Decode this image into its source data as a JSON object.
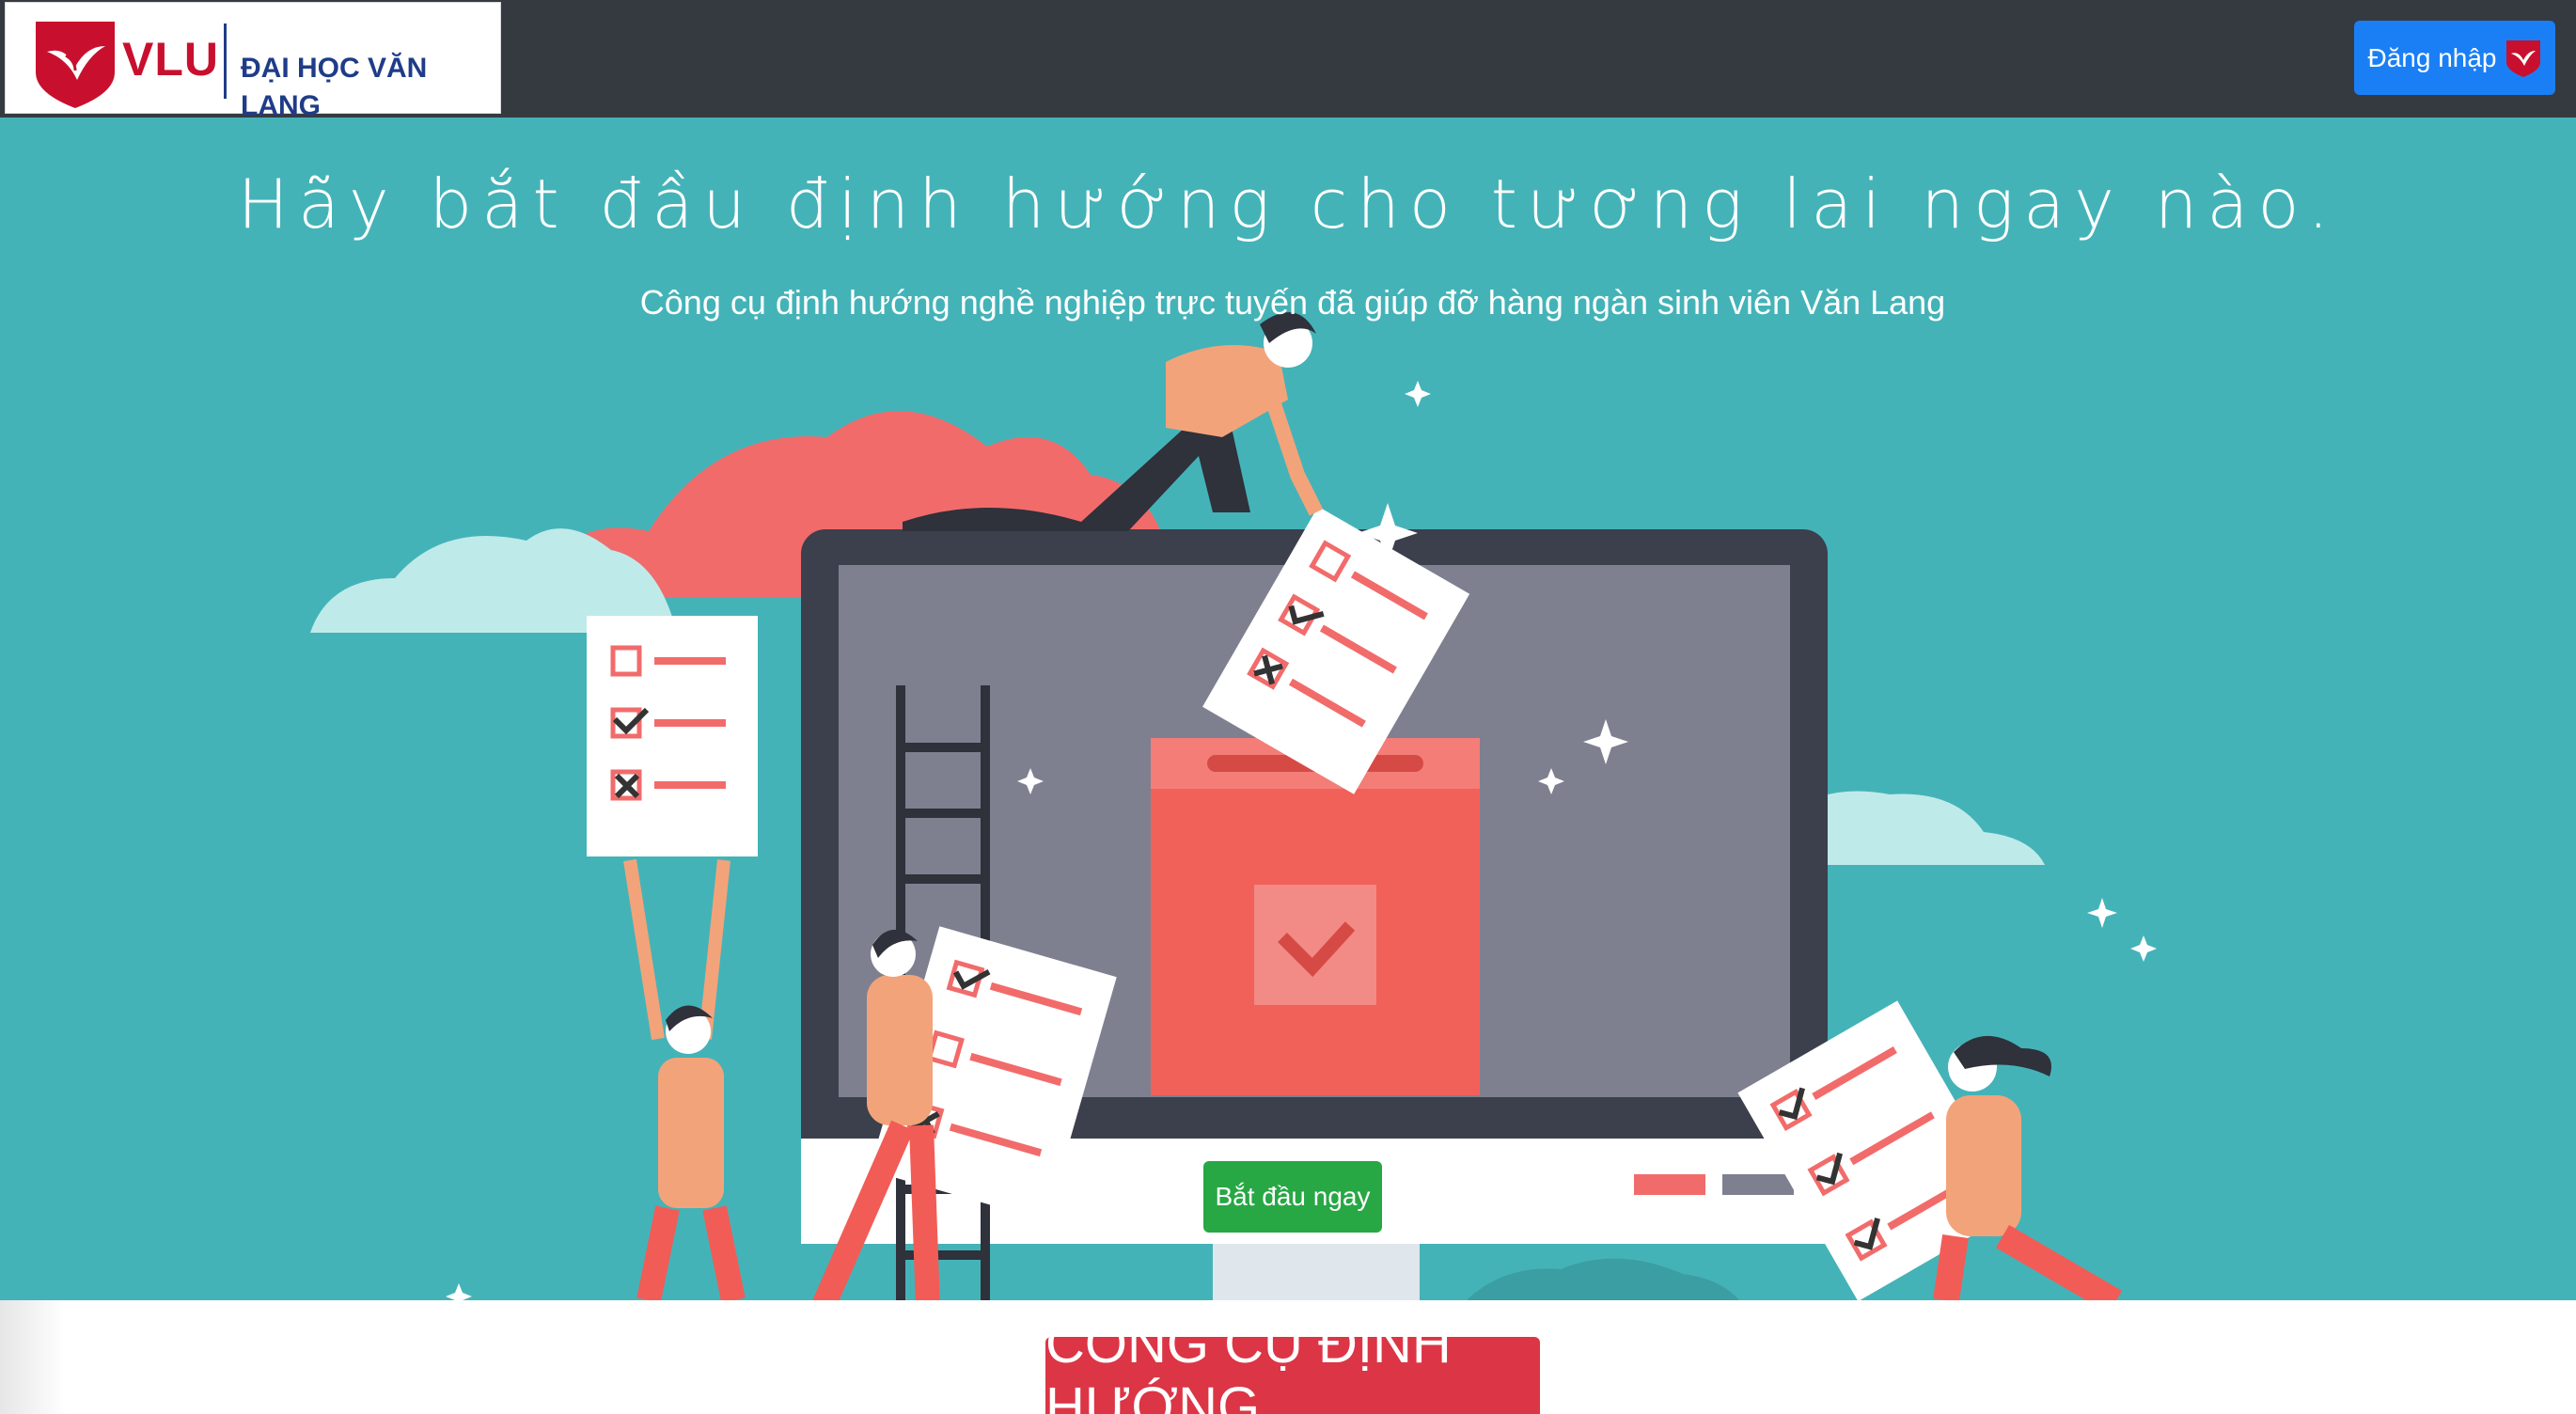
{
  "navbar": {
    "brand_short": "VLU",
    "brand_name": "ĐẠI HỌC VĂN LANG",
    "login_label": "Đăng nhập"
  },
  "hero": {
    "title": "Hãy bắt đầu định hướng cho tương lai ngay nào.",
    "subtitle": "Công cụ định hướng nghề nghiệp trực tuyến đã giúp đỡ hàng ngàn sinh viên Văn Lang",
    "cta_label": "Bắt đầu ngay"
  },
  "section": {
    "heading": "CÔNG CỤ ĐỊNH HƯỚNG"
  },
  "colors": {
    "navbar": "#343a40",
    "hero_bg": "#44b3b8",
    "login_button": "#1a7ff5",
    "cta_button": "#28a745",
    "section_heading": "#dc3545",
    "brand_red": "#c8102e",
    "brand_blue": "#1f3c88"
  },
  "icons": {
    "brand_logo": "vlu-shield-icon",
    "login_logo": "vlu-shield-icon"
  }
}
